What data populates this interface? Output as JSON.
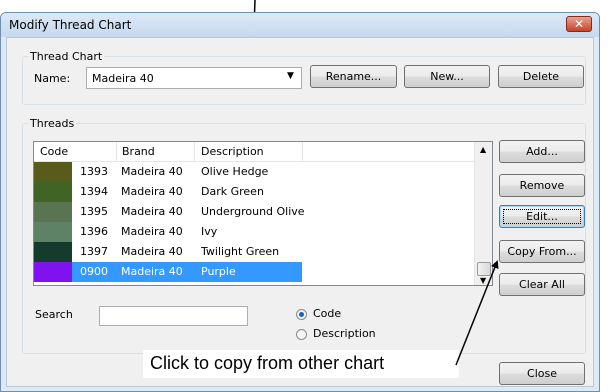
{
  "window": {
    "title": "Modify Thread Chart",
    "close_glyph": "✕"
  },
  "thread_chart": {
    "legend": "Thread Chart",
    "name_label": "Name:",
    "name_value": "Madeira 40",
    "rename_label": "Rename...",
    "new_label": "New...",
    "delete_label": "Delete"
  },
  "threads": {
    "legend": "Threads",
    "columns": [
      "Code",
      "Brand",
      "Description"
    ],
    "rows": [
      {
        "swatch": "#595b1b",
        "code": "1393",
        "brand": "Madeira 40",
        "description": "Olive Hedge"
      },
      {
        "swatch": "#3f6424",
        "code": "1394",
        "brand": "Madeira 40",
        "description": "Dark Green"
      },
      {
        "swatch": "#5a7350",
        "code": "1395",
        "brand": "Madeira 40",
        "description": "Underground Olive"
      },
      {
        "swatch": "#5e8266",
        "code": "1396",
        "brand": "Madeira 40",
        "description": "Ivy"
      },
      {
        "swatch": "#143b2c",
        "code": "1397",
        "brand": "Madeira 40",
        "description": "Twilight Green"
      },
      {
        "swatch": "#7e13f0",
        "code": "0900",
        "brand": "Madeira 40",
        "description": "Purple",
        "selected": true
      }
    ],
    "add_label": "Add...",
    "remove_label": "Remove",
    "edit_label": "Edit...",
    "copy_from_label": "Copy From...",
    "clear_all_label": "Clear All"
  },
  "search": {
    "label": "Search",
    "value": "",
    "options": [
      {
        "label": "Code",
        "checked": true
      },
      {
        "label": "Description",
        "checked": false
      }
    ]
  },
  "footer": {
    "close_label": "Close"
  },
  "annotation": {
    "text": "Click to copy from other chart"
  }
}
